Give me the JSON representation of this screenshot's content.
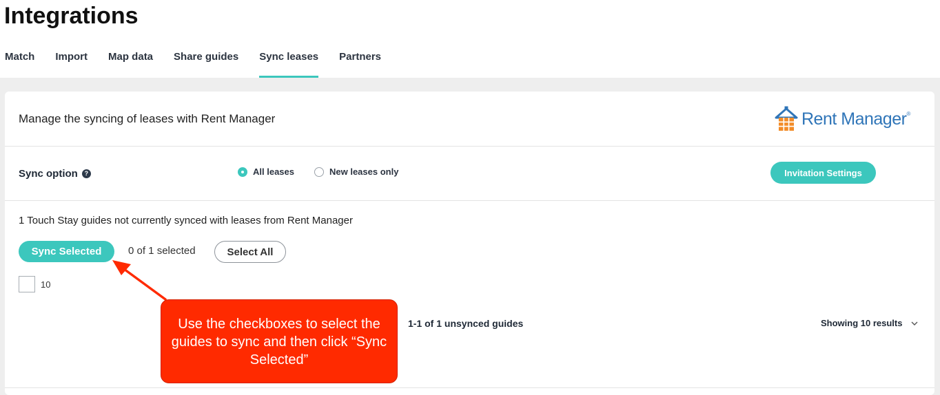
{
  "page": {
    "title": "Integrations"
  },
  "tabs": [
    {
      "label": "Match",
      "active": false
    },
    {
      "label": "Import",
      "active": false
    },
    {
      "label": "Map data",
      "active": false
    },
    {
      "label": "Share guides",
      "active": false
    },
    {
      "label": "Sync leases",
      "active": true
    },
    {
      "label": "Partners",
      "active": false
    }
  ],
  "card": {
    "header_text": "Manage the syncing of leases with Rent Manager",
    "logo": {
      "word": "Rent Manager",
      "registered": "®",
      "icon": "house-icon"
    },
    "sync_option": {
      "label": "Sync option",
      "help_icon": "?",
      "options": [
        {
          "label": "All leases",
          "checked": true
        },
        {
          "label": "New leases only",
          "checked": false
        }
      ],
      "invite_button": "Invitation Settings"
    },
    "unsynced_text": "1 Touch Stay guides not currently synced with leases from Rent Manager",
    "sync_selected_button": "Sync Selected",
    "selected_count": "0 of 1 selected",
    "select_all_button": "Select All",
    "guide_item": {
      "label": "10",
      "checked": false
    },
    "results_count": "1-1 of 1 unsynced guides",
    "showing": "Showing 10 results"
  },
  "annotation": {
    "text": "Use the checkboxes to select the guides to sync and then click “Sync Selected”"
  },
  "colors": {
    "accent": "#3cc7bd",
    "annotation": "#ff2a00",
    "logo_blue": "#2f75b8",
    "logo_orange": "#f28c28"
  }
}
